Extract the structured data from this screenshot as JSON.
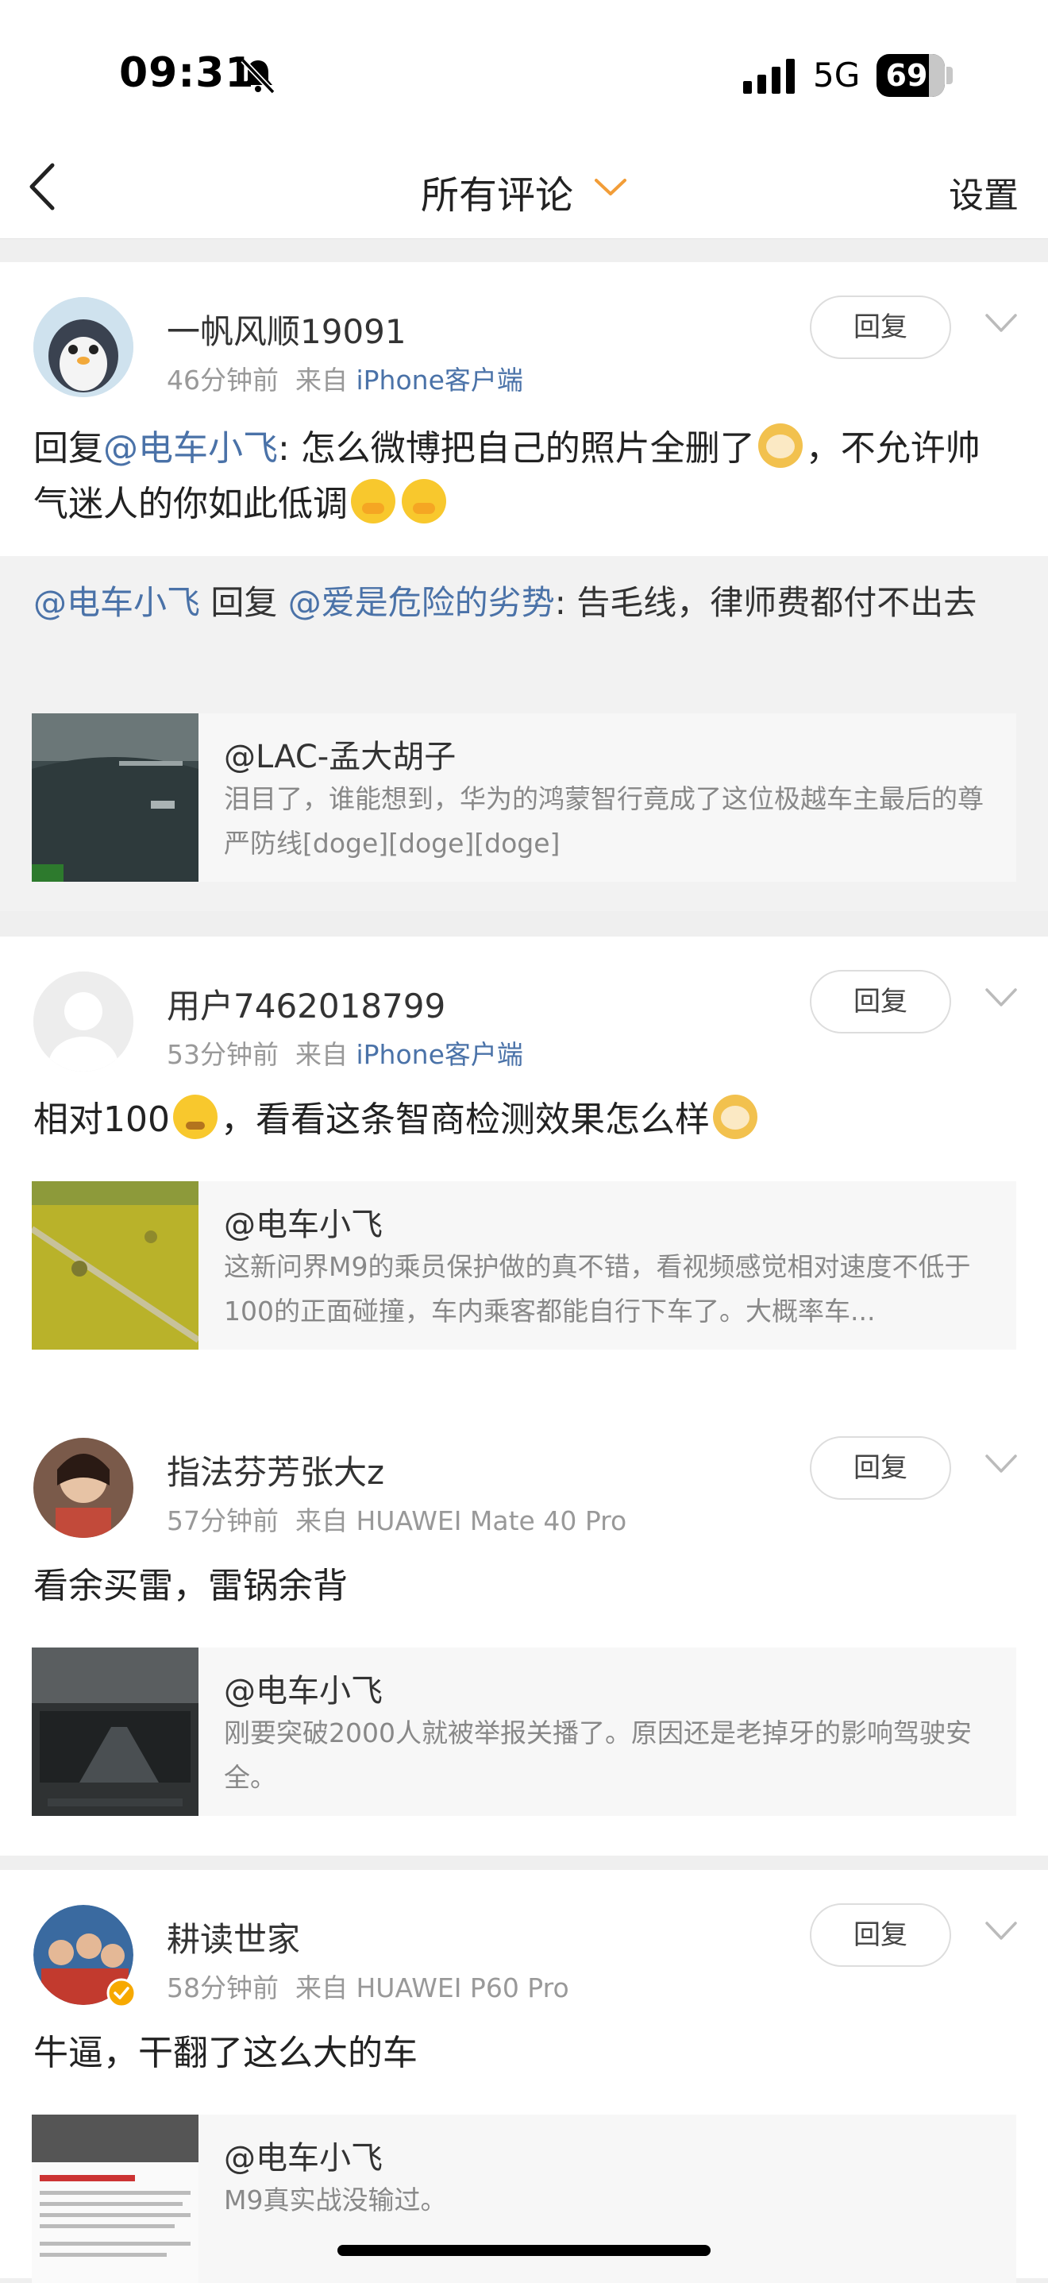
{
  "status_bar": {
    "time": "09:31",
    "network": "5G",
    "battery": "69"
  },
  "nav": {
    "title": "所有评论",
    "settings": "设置"
  },
  "comments": [
    {
      "username": "一帆风顺19091",
      "time": "46分钟前",
      "from_prefix": "来自",
      "source": "iPhone客户端",
      "reply_label": "回复",
      "content_prefix": "回复",
      "content_at": "@电车小飞",
      "content_text": ": 怎么微博把自己的照片全删了",
      "content_text2": "，不允许帅气迷人的你如此低调",
      "quote_at1": "@电车小飞",
      "quote_mid": " 回复 ",
      "quote_at2": "@爱是危险的劣势",
      "quote_text": ": 告毛线，律师费都付不出去",
      "share_title": "@LAC-孟大胡子",
      "share_desc": "泪目了，谁能想到，华为的鸿蒙智行竟成了这位极越车主最后的尊严防线[doge][doge][doge]"
    },
    {
      "username": "用户7462018799",
      "time": "53分钟前",
      "from_prefix": "来自",
      "source": "iPhone客户端",
      "reply_label": "回复",
      "content_text": "相对100",
      "content_text2": "，看看这条智商检测效果怎么样",
      "share_title": "@电车小飞",
      "share_desc": "这新问界M9的乘员保护做的真不错，看视频感觉相对速度不低于100的正面碰撞，车内乘客都能自行下车了。大概率车..."
    },
    {
      "username": "指法芬芳张大z",
      "time": "57分钟前",
      "from_prefix": "来自",
      "source": "HUAWEI Mate 40 Pro",
      "reply_label": "回复",
      "content_text": "看余买雷，雷锅余背",
      "share_title": "@电车小飞",
      "share_desc": "刚要突破2000人就被举报关播了。原因还是老掉牙的影响驾驶安全。"
    },
    {
      "username": "耕读世家",
      "time": "58分钟前",
      "from_prefix": "来自",
      "source": "HUAWEI P60 Pro",
      "reply_label": "回复",
      "content_text": "牛逼，干翻了这么大的车",
      "share_title": "@电车小飞",
      "share_desc": "M9真实战没输过。"
    }
  ]
}
